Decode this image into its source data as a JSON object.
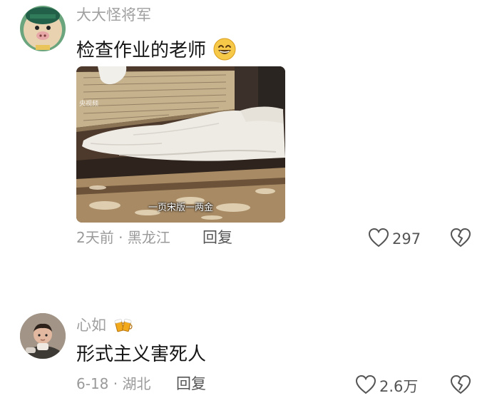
{
  "comments": [
    {
      "username": "大大怪将军",
      "text": "检查作业的老师",
      "emoji": "grinning-emoji",
      "image": {
        "caption": "一页宋版一两金",
        "watermark": "央视频"
      },
      "time": "2天前",
      "location": "黑龙江",
      "meta": "2天前 · 黑龙江",
      "reply_label": "回复",
      "like_count": "297"
    },
    {
      "username": "心如",
      "badge": "beer-cheers-icon",
      "text": "形式主义害死人",
      "time": "6-18",
      "location": "湖北",
      "meta": "6-18 · 湖北",
      "reply_label": "回复",
      "like_count": "2.6万"
    }
  ],
  "colors": {
    "username": "#a0a0a0",
    "text": "#151515",
    "meta": "#9a9a9a",
    "action": "#555555"
  }
}
